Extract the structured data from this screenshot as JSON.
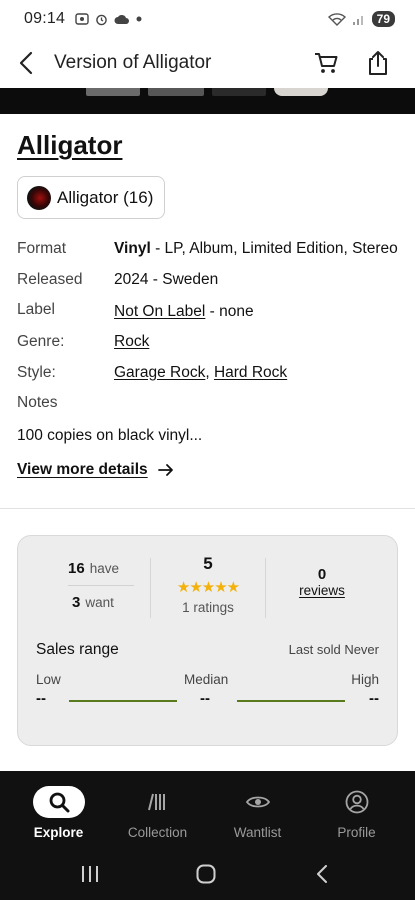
{
  "status_bar": {
    "time": "09:14",
    "battery": "79",
    "notification_icons": [
      "screenshot-icon",
      "alarm-icon",
      "cloud-icon",
      "dot-icon"
    ]
  },
  "header": {
    "title": "Version of Alligator",
    "back_icon": "back-arrow-icon",
    "cart_icon": "cart-icon",
    "share_icon": "share-icon"
  },
  "release": {
    "title": "Alligator",
    "artist_chip": "Alligator (16)",
    "details": {
      "format_label": "Format",
      "format_bold": "Vinyl",
      "format_rest": " - LP, Album, Limited Edition, Stereo",
      "released_label": "Released",
      "released_value": "2024 - Sweden",
      "label_label": "Label",
      "label_link": "Not On Label",
      "label_rest": " - none",
      "genre_label": "Genre:",
      "genre_value": "Rock",
      "style_label": "Style:",
      "style_1": "Garage Rock",
      "style_sep": ",",
      "style_2": "Hard Rock",
      "notes_label": "Notes"
    },
    "notes_text": "100 copies on black vinyl...",
    "view_more": "View more details"
  },
  "stats": {
    "have_count": "16",
    "have_label": "have",
    "want_count": "3",
    "want_label": "want",
    "rating_average": "5",
    "stars": "★★★★★",
    "ratings_label": "1 ratings",
    "reviews_count": "0",
    "reviews_label": "reviews",
    "sales_title": "Sales range",
    "last_sold": "Last sold Never",
    "low_label": "Low",
    "median_label": "Median",
    "high_label": "High",
    "low_value": "--",
    "median_value": "--",
    "high_value": "--",
    "accent_color": "#5a7a1e",
    "star_color": "#f3b10a"
  },
  "bottom_nav": {
    "items": [
      {
        "label": "Explore",
        "icon": "search-icon",
        "active": true
      },
      {
        "label": "Collection",
        "icon": "collection-icon",
        "active": false
      },
      {
        "label": "Wantlist",
        "icon": "eye-icon",
        "active": false
      },
      {
        "label": "Profile",
        "icon": "profile-icon",
        "active": false
      }
    ]
  },
  "system_nav": [
    "recents-icon",
    "home-icon",
    "back-icon"
  ]
}
